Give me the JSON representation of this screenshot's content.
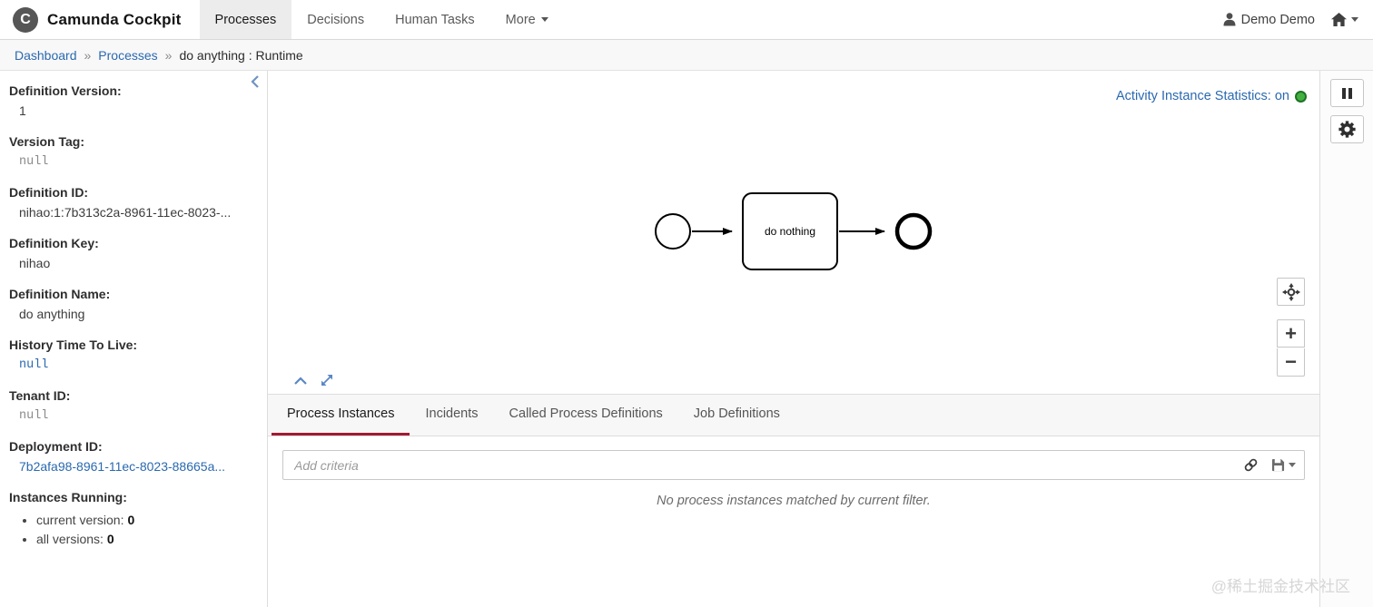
{
  "colors": {
    "accent_red": "#a31933",
    "link_blue": "#2a69b0",
    "status_green": "#44b042"
  },
  "header": {
    "app_title": "Camunda Cockpit",
    "logo_letter": "C",
    "nav": [
      {
        "label": "Processes",
        "active": true
      },
      {
        "label": "Decisions",
        "active": false
      },
      {
        "label": "Human Tasks",
        "active": false
      },
      {
        "label": "More",
        "active": false
      }
    ],
    "user_name": "Demo Demo"
  },
  "breadcrumb": {
    "separator": "»",
    "items": [
      {
        "label": "Dashboard",
        "type": "link"
      },
      {
        "label": "Processes",
        "type": "link"
      },
      {
        "label": "do anything : Runtime",
        "type": "current"
      }
    ]
  },
  "sidebar": {
    "fields": [
      {
        "label": "Definition Version:",
        "value": "1",
        "style": "plain"
      },
      {
        "label": "Version Tag:",
        "value": "null",
        "style": "code"
      },
      {
        "label": "Definition ID:",
        "value": "nihao:1:7b313c2a-8961-11ec-8023-...",
        "style": "plain"
      },
      {
        "label": "Definition Key:",
        "value": "nihao",
        "style": "plain"
      },
      {
        "label": "Definition Name:",
        "value": "do anything",
        "style": "plain"
      },
      {
        "label": "History Time To Live:",
        "value": "null",
        "style": "code-link"
      },
      {
        "label": "Tenant ID:",
        "value": "null",
        "style": "code"
      },
      {
        "label": "Deployment ID:",
        "value": "7b2afa98-8961-11ec-8023-88665a...",
        "style": "link"
      }
    ],
    "instances_running": {
      "label": "Instances Running:",
      "items": [
        {
          "label": "current version:",
          "value": "0"
        },
        {
          "label": "all versions:",
          "value": "0"
        }
      ]
    }
  },
  "diagram": {
    "stats_label": "Activity Instance Statistics: on",
    "status": "on",
    "task_label": "do nothing",
    "elements": [
      {
        "type": "startEvent"
      },
      {
        "type": "task",
        "name": "do nothing"
      },
      {
        "type": "endEvent"
      }
    ],
    "zoom_in_label": "+",
    "zoom_out_label": "−"
  },
  "tabs": [
    {
      "label": "Process Instances",
      "active": true
    },
    {
      "label": "Incidents",
      "active": false
    },
    {
      "label": "Called Process Definitions",
      "active": false
    },
    {
      "label": "Job Definitions",
      "active": false
    }
  ],
  "filter": {
    "placeholder": "Add criteria",
    "empty_message": "No process instances matched by current filter."
  },
  "icons": {
    "user": "person-icon",
    "home": "home-icon",
    "pause": "pause-icon",
    "settings": "gear-icon",
    "reset_view": "crosshair-icon",
    "collapse_panel": "chevron-up-icon",
    "expand_panel": "expand-diagonal-icon",
    "collapse_sidebar": "chevron-left-icon",
    "copy_link": "link-icon",
    "save_filter": "floppy-icon"
  },
  "watermark": "@稀土掘金技术社区"
}
